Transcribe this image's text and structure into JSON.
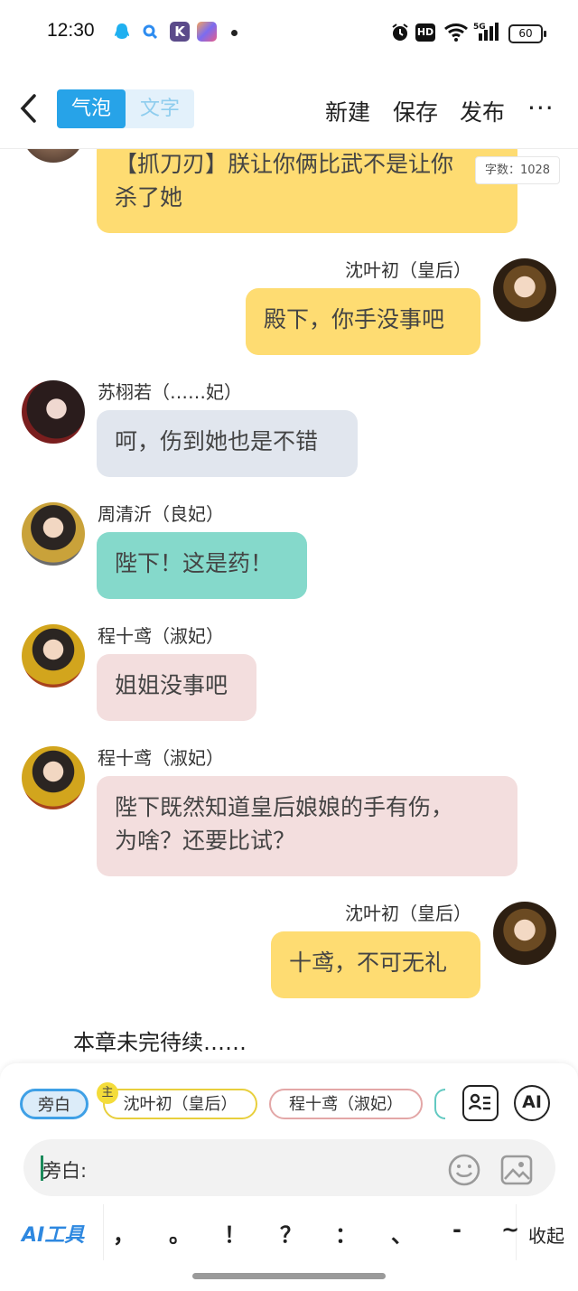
{
  "status_bar": {
    "time": "12:30",
    "battery": "60",
    "network": "5G",
    "hd": "HD"
  },
  "header": {
    "tab_bubble": "气泡",
    "tab_text": "文字",
    "new_label": "新建",
    "save_label": "保存",
    "publish_label": "发布",
    "more_label": "···"
  },
  "word_count": "字数：1028",
  "messages": [
    {
      "side": "left",
      "speaker": "",
      "text": "【抓刀刃】朕让你俩比武不是让你\n杀了她",
      "color": "#fedc72"
    },
    {
      "side": "right",
      "speaker": "沈叶初（皇后）",
      "text": "殿下，你手没事吧",
      "color": "#fedc72"
    },
    {
      "side": "left",
      "speaker": "苏栩若（……妃）",
      "text": "呵，伤到她也是不错",
      "color": "#e1e6ee"
    },
    {
      "side": "left",
      "speaker": "周清沂（良妃）",
      "text": "陛下！这是药！",
      "color": "#85d9cb"
    },
    {
      "side": "left",
      "speaker": "程十鸢（淑妃）",
      "text": "姐姐没事吧",
      "color": "#f3dede"
    },
    {
      "side": "left",
      "speaker": "程十鸢（淑妃）",
      "text": "陛下既然知道皇后娘娘的手有伤，\n为啥？还要比试？",
      "color": "#f3dede"
    },
    {
      "side": "right",
      "speaker": "沈叶初（皇后）",
      "text": "十鸢，不可无礼",
      "color": "#fedc72"
    }
  ],
  "to_be_continued": "本章未完待续……",
  "roles": [
    {
      "label": "旁白",
      "selected": true
    },
    {
      "label": "沈叶初（皇后）",
      "badge": "主"
    },
    {
      "label": "程十鸢（淑妃）"
    }
  ],
  "input": {
    "prefix": "旁白:",
    "placeholder": ""
  },
  "toolbar": {
    "ai_tool": "AI工具",
    "ai_button": "AI",
    "punctuation": [
      "，",
      "。",
      "！",
      "？",
      "：",
      "、",
      "-",
      "~"
    ],
    "collapse": "收起"
  },
  "icons": [
    "back-icon",
    "role-card-icon",
    "emoji-icon",
    "image-icon"
  ]
}
